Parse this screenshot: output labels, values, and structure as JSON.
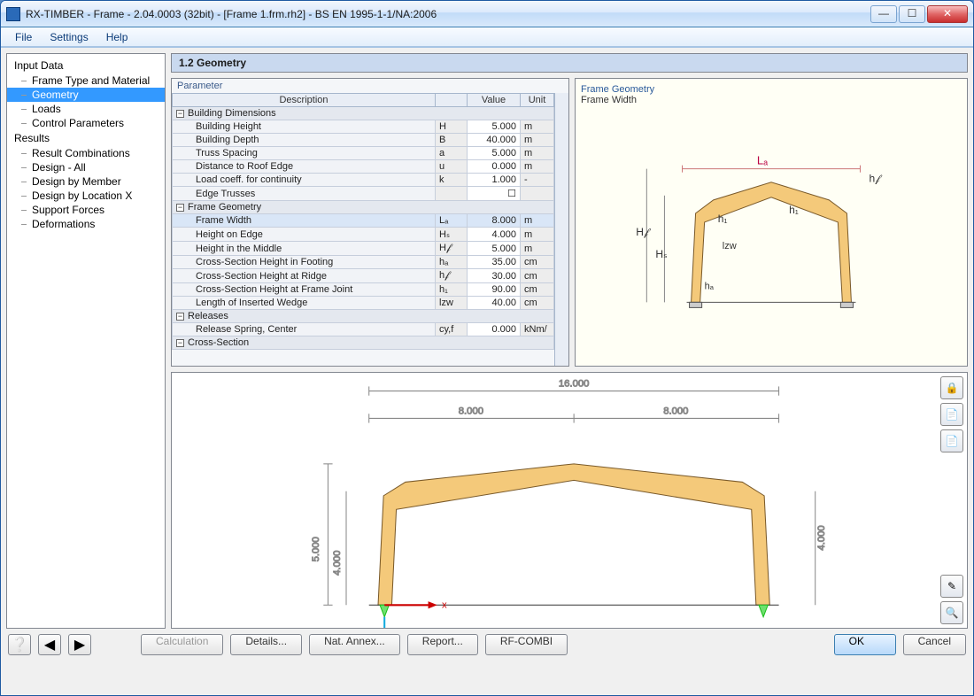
{
  "title": "RX-TIMBER - Frame - 2.04.0003 (32bit) - [Frame 1.frm.rh2] - BS EN 1995-1-1/NA:2006",
  "menubar": [
    "File",
    "Settings",
    "Help"
  ],
  "tree": {
    "input_label": "Input Data",
    "input_items": [
      "Frame Type and Material",
      "Geometry",
      "Loads",
      "Control Parameters"
    ],
    "input_selected": 1,
    "results_label": "Results",
    "results_items": [
      "Result Combinations",
      "Design - All",
      "Design by Member",
      "Design by Location X",
      "Support Forces",
      "Deformations"
    ]
  },
  "section_title": "1.2 Geometry",
  "param_header": "Parameter",
  "columns": {
    "desc": "Description",
    "value": "Value",
    "unit": "Unit"
  },
  "groups": [
    {
      "name": "Building Dimensions",
      "rows": [
        {
          "desc": "Building Height",
          "sym": "H",
          "val": "5.000",
          "unit": "m"
        },
        {
          "desc": "Building Depth",
          "sym": "B",
          "val": "40.000",
          "unit": "m"
        },
        {
          "desc": "Truss Spacing",
          "sym": "a",
          "val": "5.000",
          "unit": "m"
        },
        {
          "desc": "Distance to Roof Edge",
          "sym": "u",
          "val": "0.000",
          "unit": "m"
        },
        {
          "desc": "Load coeff. for continuity",
          "sym": "k",
          "val": "1.000",
          "unit": "-"
        },
        {
          "desc": "Edge Trusses",
          "sym": "",
          "val": "☐",
          "unit": ""
        }
      ]
    },
    {
      "name": "Frame Geometry",
      "rows": [
        {
          "desc": "Frame Width",
          "sym": "Lₐ",
          "val": "8.000",
          "unit": "m",
          "sel": true
        },
        {
          "desc": "Height on Edge",
          "sym": "Hₛ",
          "val": "4.000",
          "unit": "m"
        },
        {
          "desc": "Height in the Middle",
          "sym": "H𝒻",
          "val": "5.000",
          "unit": "m"
        },
        {
          "desc": "Cross-Section Height in Footing",
          "sym": "hₐ",
          "val": "35.00",
          "unit": "cm"
        },
        {
          "desc": "Cross-Section Height at Ridge",
          "sym": "h𝒻",
          "val": "30.00",
          "unit": "cm"
        },
        {
          "desc": "Cross-Section Height at Frame Joint",
          "sym": "h₁",
          "val": "90.00",
          "unit": "cm"
        },
        {
          "desc": "Length of Inserted Wedge",
          "sym": "lzw",
          "val": "40.00",
          "unit": "cm"
        }
      ]
    },
    {
      "name": "Releases",
      "rows": [
        {
          "desc": "Release Spring, Center",
          "sym": "cy,f",
          "val": "0.000",
          "unit": "kNm/"
        }
      ]
    },
    {
      "name": "Cross-Section",
      "rows": []
    }
  ],
  "info": {
    "title": "Frame Geometry",
    "sub": "Frame Width"
  },
  "diagram": {
    "top_span": "16.000",
    "half_span": "8.000",
    "height_left": "5.000",
    "height_inner": "4.000",
    "axis_x": "x",
    "labels": {
      "La": "Lₐ",
      "hf": "h𝒻",
      "Hf": "H𝒻",
      "Hs": "Hₛ",
      "h1": "h₁",
      "lzw": "lzw",
      "ha": "hₐ"
    }
  },
  "footer": {
    "calc": "Calculation",
    "details": "Details...",
    "nat": "Nat. Annex...",
    "report": "Report...",
    "rfcombi": "RF-COMBI",
    "ok": "OK",
    "cancel": "Cancel"
  }
}
